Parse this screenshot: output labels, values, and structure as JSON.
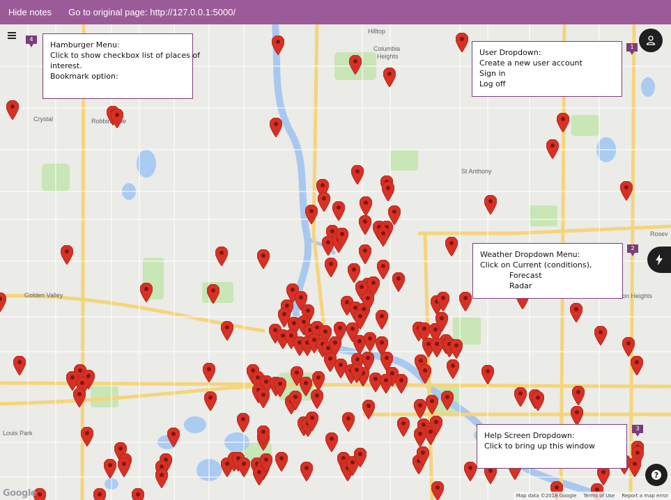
{
  "topbar": {
    "hide_notes": "Hide notes",
    "original_page": "Go to original page: http://127.0.0.1:5000/"
  },
  "map": {
    "places": [
      "Hilltop",
      "Columbia Heights",
      "Crystal",
      "Robbinsdale",
      "St Anthony",
      "Golden Valley",
      "Louis Park",
      "Roseville",
      "Lauderdale Heights"
    ],
    "place_labels": {
      "hilltop": "Hilltop",
      "columbia_1": "Columbia",
      "columbia_2": "Heights",
      "crystal": "Crystal",
      "robbinsdale": "Robbinsdale",
      "st_anthony": "St Anthony",
      "golden_valley": "Golden Valley",
      "louis_park": "Louis Park",
      "rosev": "Rosev",
      "on_heights": "on Heights"
    },
    "marker_color": "#d93025",
    "google": "Google",
    "attribution": {
      "data": "Map data ©2018 Google",
      "terms": "Terms of Use",
      "report": "Report a map error"
    }
  },
  "notes": {
    "hamburger": {
      "badge": "4",
      "lines": [
        "Hamburger Menu:",
        "Click to show checkbox list of places of",
        "interest.",
        "",
        "Bookmark option:"
      ]
    },
    "user": {
      "badge": "1",
      "lines": [
        "User Dropdown:",
        "Create a new user account",
        "Sign in",
        "Log off"
      ]
    },
    "weather": {
      "badge": "2",
      "lines": [
        "Weather Dropdown Menu:",
        "Click on Current (conditions),",
        "            Forecast",
        "            Radar"
      ]
    },
    "help": {
      "badge": "3",
      "lines": [
        "Help Screen Dropdown:",
        "Click to bring up this window"
      ]
    }
  },
  "icons": {
    "hamburger": "hamburger-icon",
    "user": "user-icon",
    "weather": "lightning-icon",
    "help": "question-icon"
  },
  "colors": {
    "topbar": "#9b5b98",
    "note_border": "#7b3d7a",
    "marker": "#d93025",
    "button": "#1f1f1f"
  }
}
